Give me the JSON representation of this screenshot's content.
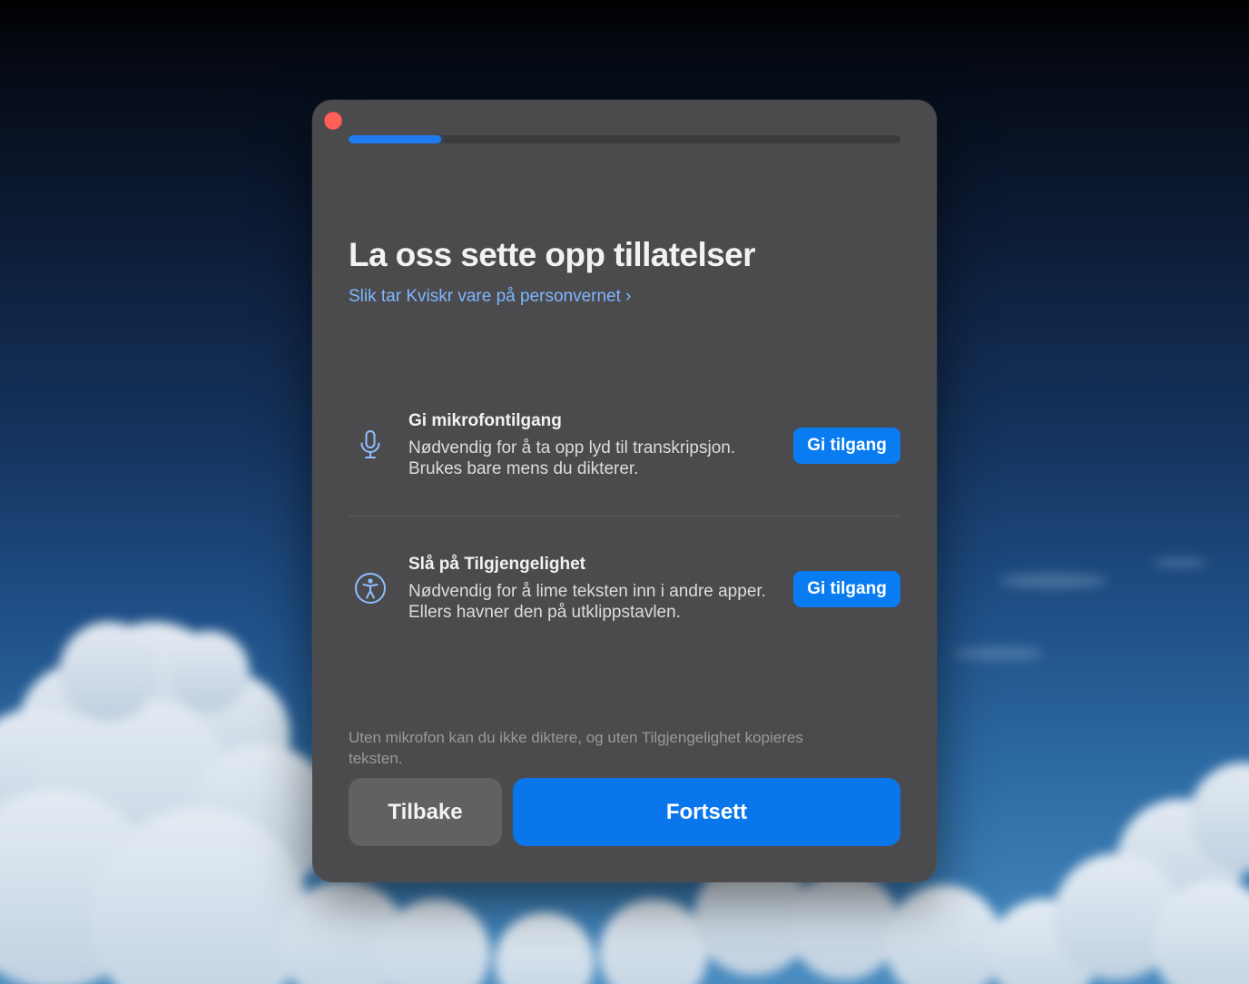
{
  "window": {
    "progress_fraction": 0.167
  },
  "header": {
    "title": "La oss sette opp tillatelser",
    "privacy_link": "Slik tar Kviskr vare på personvernet ›"
  },
  "permissions": [
    {
      "icon": "microphone-icon",
      "title": "Gi mikrofontilgang",
      "description": "Nødvendig for å ta opp lyd til transkripsjon. Brukes bare mens du dikterer.",
      "button_label": "Gi tilgang"
    },
    {
      "icon": "accessibility-icon",
      "title": "Slå på Tilgjengelighet",
      "description": "Nødvendig for å lime teksten inn i andre apper. Ellers havner den på utklippstavlen.",
      "button_label": "Gi tilgang"
    }
  ],
  "footer": {
    "note": "Uten mikrofon kan du ikke diktere, og uten Tilgjengelighet kopieres teksten.",
    "back_label": "Tilbake",
    "continue_label": "Fortsett"
  },
  "colors": {
    "accent": "#0a7cf2",
    "link": "#7fb6ff",
    "close": "#ff5f57",
    "window_bg": "#4b4b4d"
  }
}
